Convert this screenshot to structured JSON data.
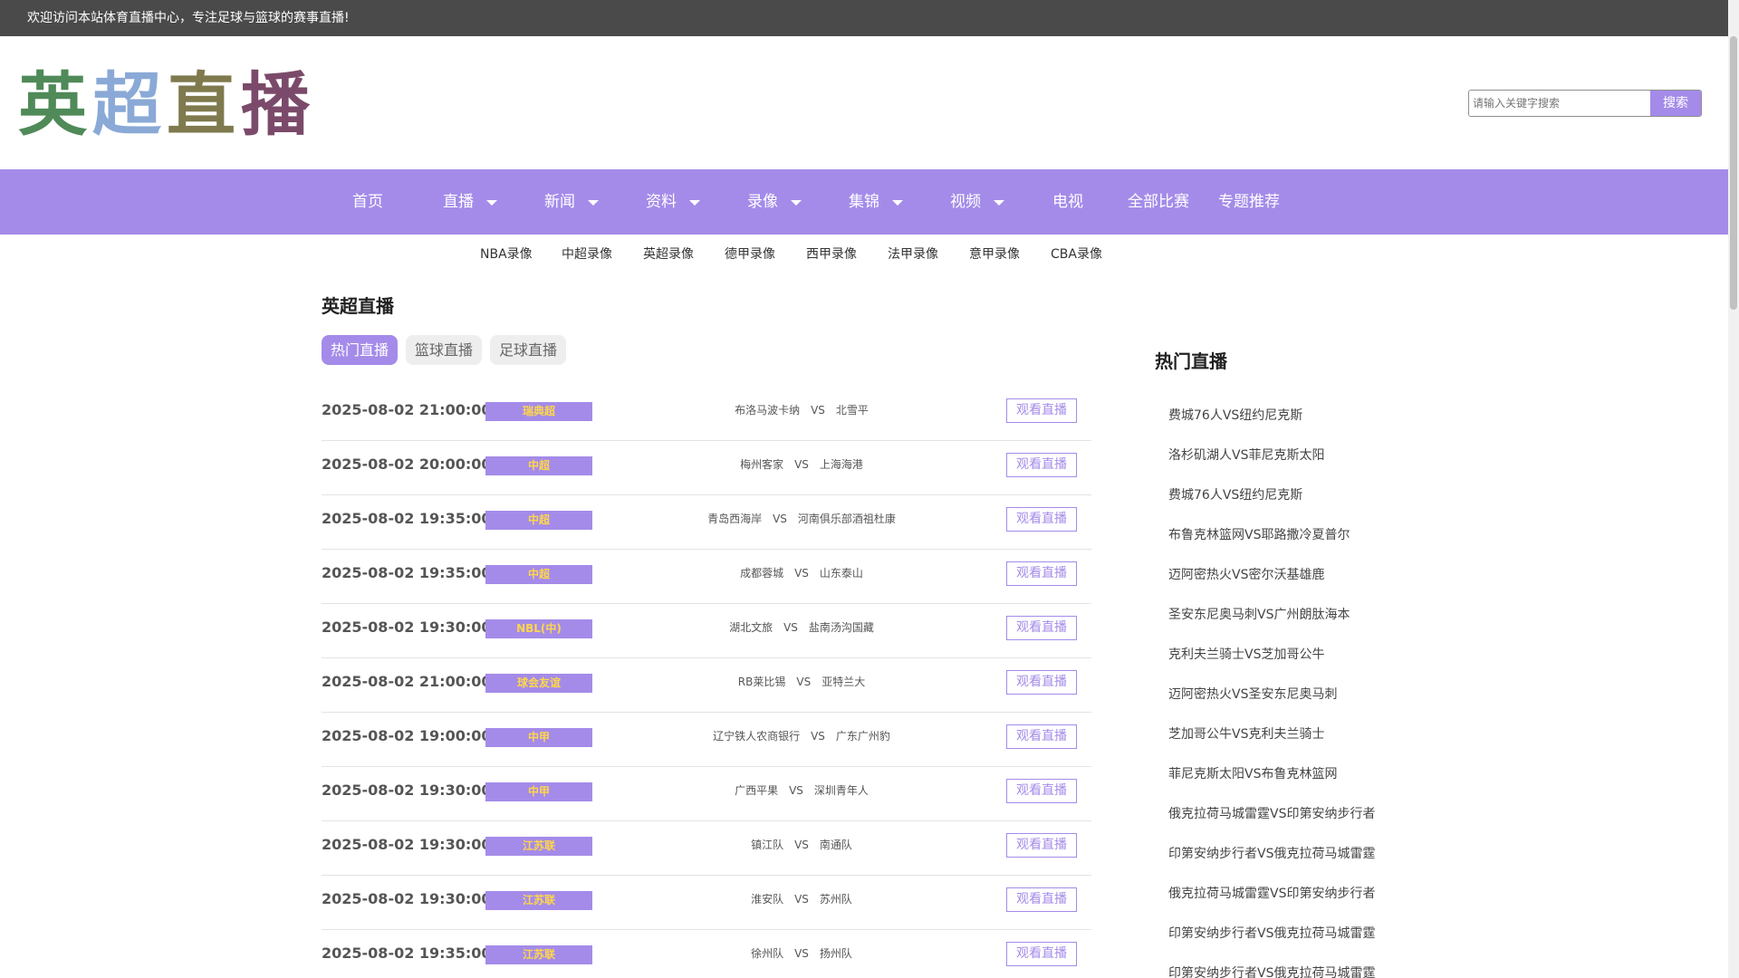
{
  "topbar": {
    "welcome": "欢迎访问本站体育直播中心，专注足球与篮球的赛事直播!"
  },
  "logo": {
    "chars": [
      "英",
      "超",
      "直",
      "播"
    ],
    "colors": [
      "#4f8a58",
      "#8aa9d6",
      "#7f7a4e",
      "#7b4a6a"
    ]
  },
  "search": {
    "placeholder": "请输入关键字搜索",
    "button": "搜索"
  },
  "nav": {
    "items": [
      {
        "label": "首页",
        "dropdown": false
      },
      {
        "label": "直播",
        "dropdown": true
      },
      {
        "label": "新闻",
        "dropdown": true
      },
      {
        "label": "资料",
        "dropdown": true
      },
      {
        "label": "录像",
        "dropdown": true
      },
      {
        "label": "集锦",
        "dropdown": true
      },
      {
        "label": "视频",
        "dropdown": true
      },
      {
        "label": "电视",
        "dropdown": false
      },
      {
        "label": "全部比赛",
        "dropdown": false
      },
      {
        "label": "专题推荐",
        "dropdown": false
      }
    ]
  },
  "subnav": {
    "items": [
      "NBA录像",
      "中超录像",
      "英超录像",
      "德甲录像",
      "西甲录像",
      "法甲录像",
      "意甲录像",
      "CBA录像"
    ]
  },
  "main": {
    "title": "英超直播",
    "tabs": [
      {
        "label": "热门直播",
        "active": true
      },
      {
        "label": "篮球直播",
        "active": false
      },
      {
        "label": "足球直播",
        "active": false
      }
    ],
    "vs_label": "VS",
    "watch_label": "观看直播",
    "matches": [
      {
        "time": "2025-08-02 21:00:00",
        "league": "瑞典超",
        "home": "布洛马波卡纳",
        "away": "北雪平"
      },
      {
        "time": "2025-08-02 20:00:00",
        "league": "中超",
        "home": "梅州客家",
        "away": "上海海港"
      },
      {
        "time": "2025-08-02 19:35:00",
        "league": "中超",
        "home": "青岛西海岸",
        "away": "河南俱乐部酒祖杜康"
      },
      {
        "time": "2025-08-02 19:35:00",
        "league": "中超",
        "home": "成都蓉城",
        "away": "山东泰山"
      },
      {
        "time": "2025-08-02 19:30:00",
        "league": "NBL(中)",
        "home": "湖北文旅",
        "away": "盐南汤沟国藏"
      },
      {
        "time": "2025-08-02 21:00:00",
        "league": "球会友谊",
        "home": "RB莱比锡",
        "away": "亚特兰大"
      },
      {
        "time": "2025-08-02 19:00:00",
        "league": "中甲",
        "home": "辽宁铁人农商银行",
        "away": "广东广州豹"
      },
      {
        "time": "2025-08-02 19:30:00",
        "league": "中甲",
        "home": "广西平果",
        "away": "深圳青年人"
      },
      {
        "time": "2025-08-02 19:30:00",
        "league": "江苏联",
        "home": "镇江队",
        "away": "南通队"
      },
      {
        "time": "2025-08-02 19:30:00",
        "league": "江苏联",
        "home": "淮安队",
        "away": "苏州队"
      },
      {
        "time": "2025-08-02 19:35:00",
        "league": "江苏联",
        "home": "徐州队",
        "away": "扬州队"
      }
    ]
  },
  "sidebar": {
    "title": "热门直播",
    "items": [
      "费城76人VS纽约尼克斯",
      "洛杉矶湖人VS菲尼克斯太阳",
      "费城76人VS纽约尼克斯",
      "布鲁克林篮网VS耶路撒冷夏普尔",
      "迈阿密热火VS密尔沃基雄鹿",
      "圣安东尼奥马刺VS广州朗肽海本",
      "克利夫兰骑士VS芝加哥公牛",
      "迈阿密热火VS圣安东尼奥马刺",
      "芝加哥公牛VS克利夫兰骑士",
      "菲尼克斯太阳VS布鲁克林篮网",
      "俄克拉荷马城雷霆VS印第安纳步行者",
      "印第安纳步行者VS俄克拉荷马城雷霆",
      "俄克拉荷马城雷霆VS印第安纳步行者",
      "印第安纳步行者VS俄克拉荷马城雷霆",
      "印第安纳步行者VS俄克拉荷马城雷霆"
    ]
  }
}
